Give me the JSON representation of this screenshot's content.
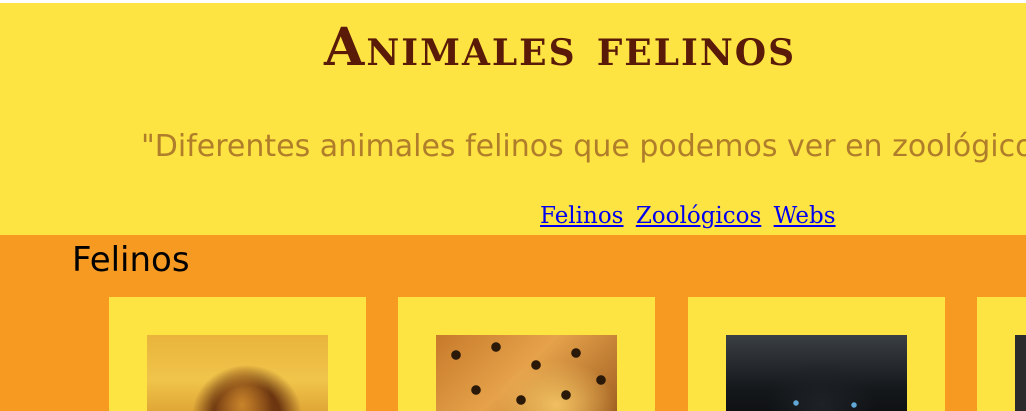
{
  "header": {
    "title": "Animales felinos",
    "subtitle": "\"Diferentes animales felinos que podemos ver en zoológicos",
    "nav": [
      {
        "label": "Felinos"
      },
      {
        "label": "Zoológicos"
      },
      {
        "label": "Webs"
      }
    ]
  },
  "main": {
    "section_title": "Felinos",
    "cards": [
      {
        "photo": "lion"
      },
      {
        "photo": "leopard"
      },
      {
        "photo": "black-panther"
      },
      {
        "photo": "unknown"
      }
    ]
  },
  "colors": {
    "header_bg": "#fde442",
    "content_bg": "#f69a22",
    "title": "#5a1a08",
    "subtitle": "#b07e2a",
    "link": "#0000ee"
  }
}
